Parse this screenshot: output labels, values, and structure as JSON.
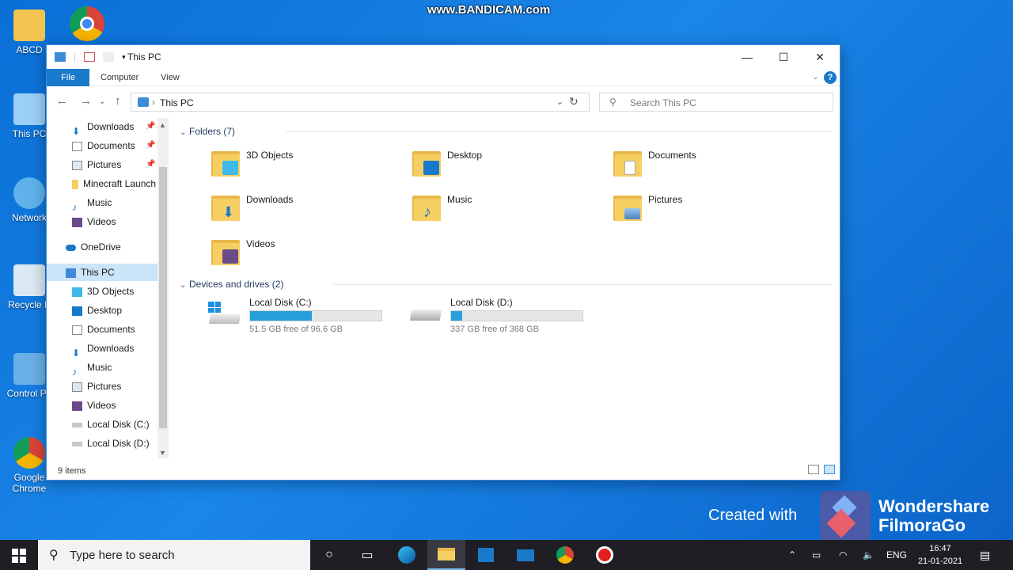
{
  "watermark": {
    "top": "www.BANDICAM.com",
    "created_with": "Created with",
    "brand_line1": "Wondershare",
    "brand_line2": "FilmoraGo"
  },
  "desktop_icons": [
    {
      "label": "ABCD"
    },
    {
      "label": "This PC"
    },
    {
      "label": "Network"
    },
    {
      "label": "Recycle B"
    },
    {
      "label": "Control Pa"
    },
    {
      "label": "Google Chrome"
    }
  ],
  "window": {
    "title": "This PC",
    "controls": {
      "minimize": "—",
      "maximize": "☐",
      "close": "✕"
    },
    "ribbon": {
      "file": "File",
      "computer": "Computer",
      "view": "View",
      "help": "?"
    },
    "address": {
      "path": "This PC"
    },
    "search": {
      "placeholder": "Search This PC"
    },
    "status": {
      "items": "9 items"
    }
  },
  "sidebar": {
    "quick": [
      {
        "label": "Downloads",
        "icon": "download-icon",
        "pinned": true
      },
      {
        "label": "Documents",
        "icon": "document-icon",
        "pinned": true
      },
      {
        "label": "Pictures",
        "icon": "pictures-icon",
        "pinned": true
      },
      {
        "label": "Minecraft Launch",
        "icon": "folder-icon",
        "pinned": false
      },
      {
        "label": "Music",
        "icon": "music-icon",
        "pinned": false
      },
      {
        "label": "Videos",
        "icon": "videos-icon",
        "pinned": false
      }
    ],
    "onedrive": "OneDrive",
    "thispc": "This PC",
    "pc_items": [
      "3D Objects",
      "Desktop",
      "Documents",
      "Downloads",
      "Music",
      "Pictures",
      "Videos",
      "Local Disk (C:)",
      "Local Disk (D:)"
    ]
  },
  "content": {
    "folders_header": "Folders (7)",
    "folders": [
      "3D Objects",
      "Desktop",
      "Documents",
      "Downloads",
      "Music",
      "Pictures",
      "Videos"
    ],
    "drives_header": "Devices and drives (2)",
    "drives": [
      {
        "label": "Local Disk (C:)",
        "sub": "51.5 GB free of 96.6 GB",
        "used_fraction": 0.467
      },
      {
        "label": "Local Disk (D:)",
        "sub": "337 GB free of 368 GB",
        "used_fraction": 0.084
      }
    ]
  },
  "taskbar": {
    "search_placeholder": "Type here to search",
    "lang": "ENG",
    "time": "16:47",
    "date": "21-01-2021"
  },
  "colors": {
    "accent": "#1979ca",
    "drive_fill": "#26a0da",
    "selection": "#cce4f7",
    "folder": "#f6cf63"
  }
}
